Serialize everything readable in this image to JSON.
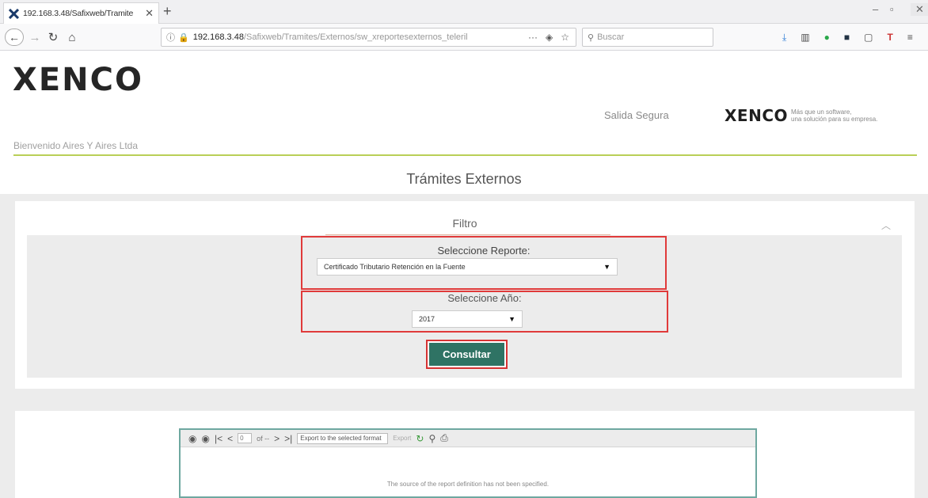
{
  "browser": {
    "tab_title": "192.168.3.48/Safixweb/Tramite",
    "url_host": "192.168.3.48",
    "url_path": "/Safixweb/Tramites/Externos/sw_xreportesexternos_teleril",
    "search_placeholder": "Buscar"
  },
  "header": {
    "logo": "XENCO",
    "logout_link": "Salida Segura",
    "brand_mark": "XENCO",
    "tagline_line1": "Más que un software,",
    "tagline_line2": "una solución para su empresa."
  },
  "welcome": "Bienvenido Aires Y Aires Ltda",
  "page_title": "Trámites Externos",
  "filter": {
    "title": "Filtro",
    "report_label": "Seleccione Reporte:",
    "report_value": "Certificado Tributario Retención en la Fuente",
    "year_label": "Seleccione Año:",
    "year_value": "2017",
    "submit_label": "Consultar"
  },
  "viewer": {
    "page_value": "0",
    "of_label": "of --",
    "export_format": "Export to the selected format",
    "export_label": "Export",
    "message": "The source of the report definition has not been specified."
  },
  "colors": {
    "accent_green_line": "#b9cf57",
    "button_bg": "#2f7364",
    "highlight_red": "#e03a3a"
  }
}
